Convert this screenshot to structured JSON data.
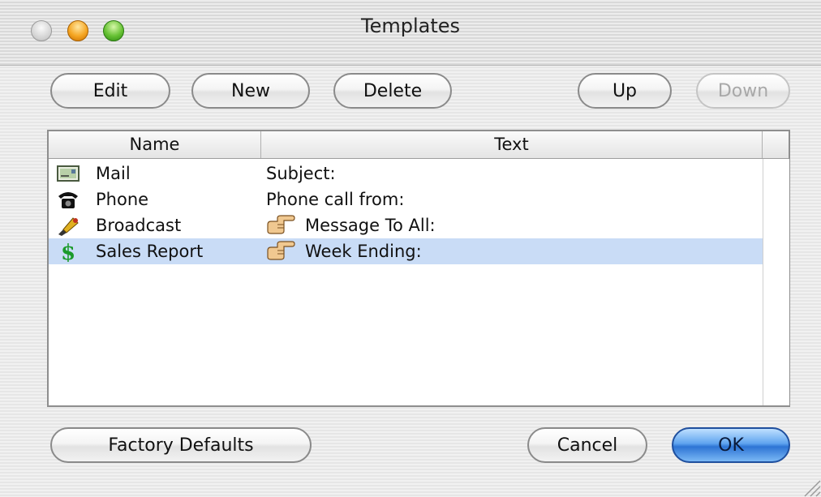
{
  "window": {
    "title": "Templates"
  },
  "toolbar": {
    "edit": "Edit",
    "new": "New",
    "delete": "Delete",
    "up": "Up",
    "down": "Down"
  },
  "table": {
    "columns": [
      "Name",
      "Text"
    ],
    "rows": [
      {
        "name": "Mail",
        "text": "Subject:",
        "icon": "mail-icon"
      },
      {
        "name": "Phone",
        "text": "Phone call from:",
        "icon": "telephone-icon"
      },
      {
        "name": "Broadcast",
        "text": "Message To All:",
        "icon": "megaphone-icon",
        "text_icon": "pointing-hand-icon"
      },
      {
        "name": "Sales Report",
        "text": "Week Ending:",
        "icon": "dollar-icon",
        "text_icon": "pointing-hand-icon",
        "selected": true
      }
    ]
  },
  "footer": {
    "factory_defaults": "Factory Defaults",
    "cancel": "Cancel",
    "ok": "OK"
  },
  "colors": {
    "selection": "#c9dcf6",
    "ok_button": "#2d74d4",
    "dollar": "#1a9a2a"
  }
}
